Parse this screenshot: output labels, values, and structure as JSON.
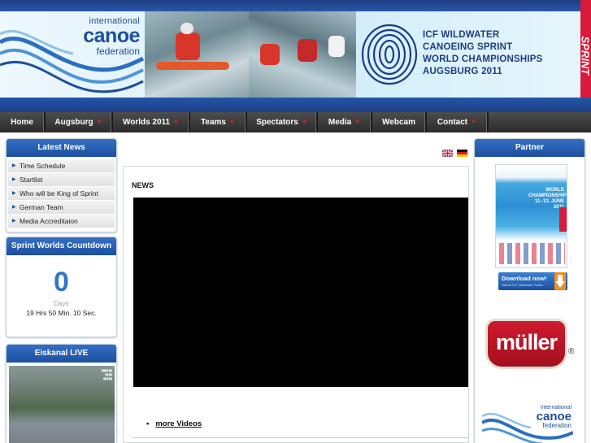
{
  "header": {
    "logo_line1": "international",
    "logo_line2": "canoe",
    "logo_line3": "federation",
    "event_line1": "ICF WILDWATER",
    "event_line2": "CANOEING SPRINT",
    "event_line3": "WORLD CHAMPIONSHIPS",
    "event_line4": "AUGSBURG 2011",
    "sprint_label": "SPRINT"
  },
  "nav": {
    "items": [
      {
        "label": "Home",
        "dropdown": false
      },
      {
        "label": "Augsburg",
        "dropdown": true
      },
      {
        "label": "Worlds 2011",
        "dropdown": true
      },
      {
        "label": "Teams",
        "dropdown": true
      },
      {
        "label": "Spectators",
        "dropdown": true
      },
      {
        "label": "Media",
        "dropdown": true
      },
      {
        "label": "Webcam",
        "dropdown": false
      },
      {
        "label": "Contact",
        "dropdown": true
      }
    ]
  },
  "latest_news": {
    "title": "Latest News",
    "items": [
      "Time Schedule",
      "Startlist",
      "Who will be King of Sprint",
      "German Team",
      "Media Accreditaion"
    ]
  },
  "countdown": {
    "title": "Sprint Worlds Countdown",
    "days_value": "0",
    "days_label": "Days",
    "remaining": "19 Hrs 50 Min. 10 Sec."
  },
  "eiskanal": {
    "title": "Eiskanal LIVE"
  },
  "main": {
    "heading": "NEWS",
    "more_videos": "more Videos"
  },
  "partner": {
    "title": "Partner",
    "poster_line1": "WORLD",
    "poster_line2": "CHAMPIONSHIPS",
    "poster_line3": "11.-13. JUNE",
    "poster_line4": "2011",
    "download_label": "Download now!",
    "download_sub": "Official ICF Wildwater Poster",
    "sponsor_name": "müller",
    "sponsor_mark": "®",
    "icf_line1": "international",
    "icf_line2": "canoe",
    "icf_line3": "federation"
  },
  "colors": {
    "brand_blue": "#1d4f9e",
    "sprint_red": "#d81b3b",
    "countdown_blue": "#2f78c8",
    "nav_bg": "#3a3a3a"
  }
}
